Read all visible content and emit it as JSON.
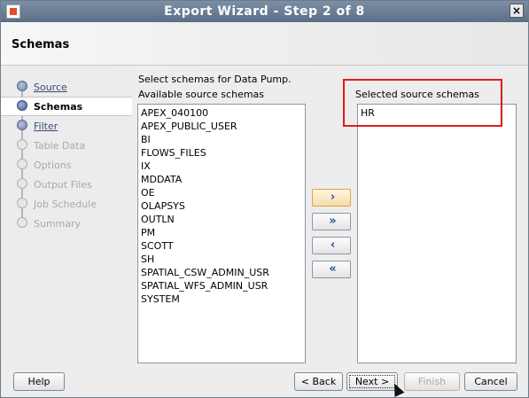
{
  "window": {
    "title": "Export Wizard - Step 2 of 8",
    "close_label": "×"
  },
  "header": {
    "title": "Schemas"
  },
  "nav": {
    "steps": [
      {
        "label": "Source",
        "state": "link"
      },
      {
        "label": "Schemas",
        "state": "active"
      },
      {
        "label": "Filter",
        "state": "link"
      },
      {
        "label": "Table Data",
        "state": "disabled"
      },
      {
        "label": "Options",
        "state": "disabled"
      },
      {
        "label": "Output Files",
        "state": "disabled"
      },
      {
        "label": "Job Schedule",
        "state": "disabled"
      },
      {
        "label": "Summary",
        "state": "disabled"
      }
    ]
  },
  "content": {
    "instruction": "Select schemas for Data Pump.",
    "available_label": "Available source schemas",
    "selected_label": "Selected source schemas",
    "available": [
      "APEX_040100",
      "APEX_PUBLIC_USER",
      "BI",
      "FLOWS_FILES",
      "IX",
      "MDDATA",
      "OE",
      "OLAPSYS",
      "OUTLN",
      "PM",
      "SCOTT",
      "SH",
      "SPATIAL_CSW_ADMIN_USR",
      "SPATIAL_WFS_ADMIN_USR",
      "SYSTEM"
    ],
    "selected": [
      "HR"
    ]
  },
  "move_buttons": {
    "add": "›",
    "add_all": "»",
    "remove": "‹",
    "remove_all": "«"
  },
  "footer": {
    "help": "Help",
    "back": "< Back",
    "next": "Next >",
    "finish": "Finish",
    "cancel": "Cancel"
  },
  "colors": {
    "highlight": "#e31b1b",
    "title_bar": "#6a7c93"
  }
}
